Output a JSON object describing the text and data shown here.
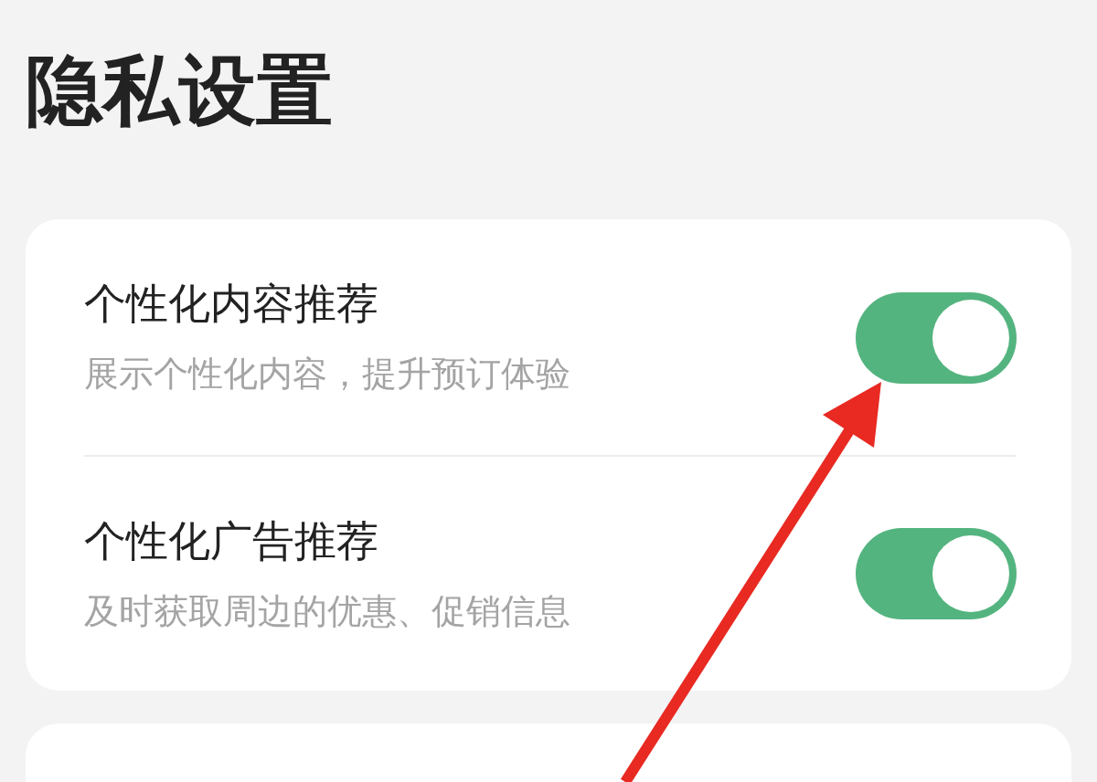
{
  "page": {
    "title": "隐私设置"
  },
  "settings": [
    {
      "title": "个性化内容推荐",
      "subtitle": "展示个性化内容，提升预订体验",
      "on": true
    },
    {
      "title": "个性化广告推荐",
      "subtitle": "及时获取周边的优惠、促销信息",
      "on": true
    }
  ]
}
